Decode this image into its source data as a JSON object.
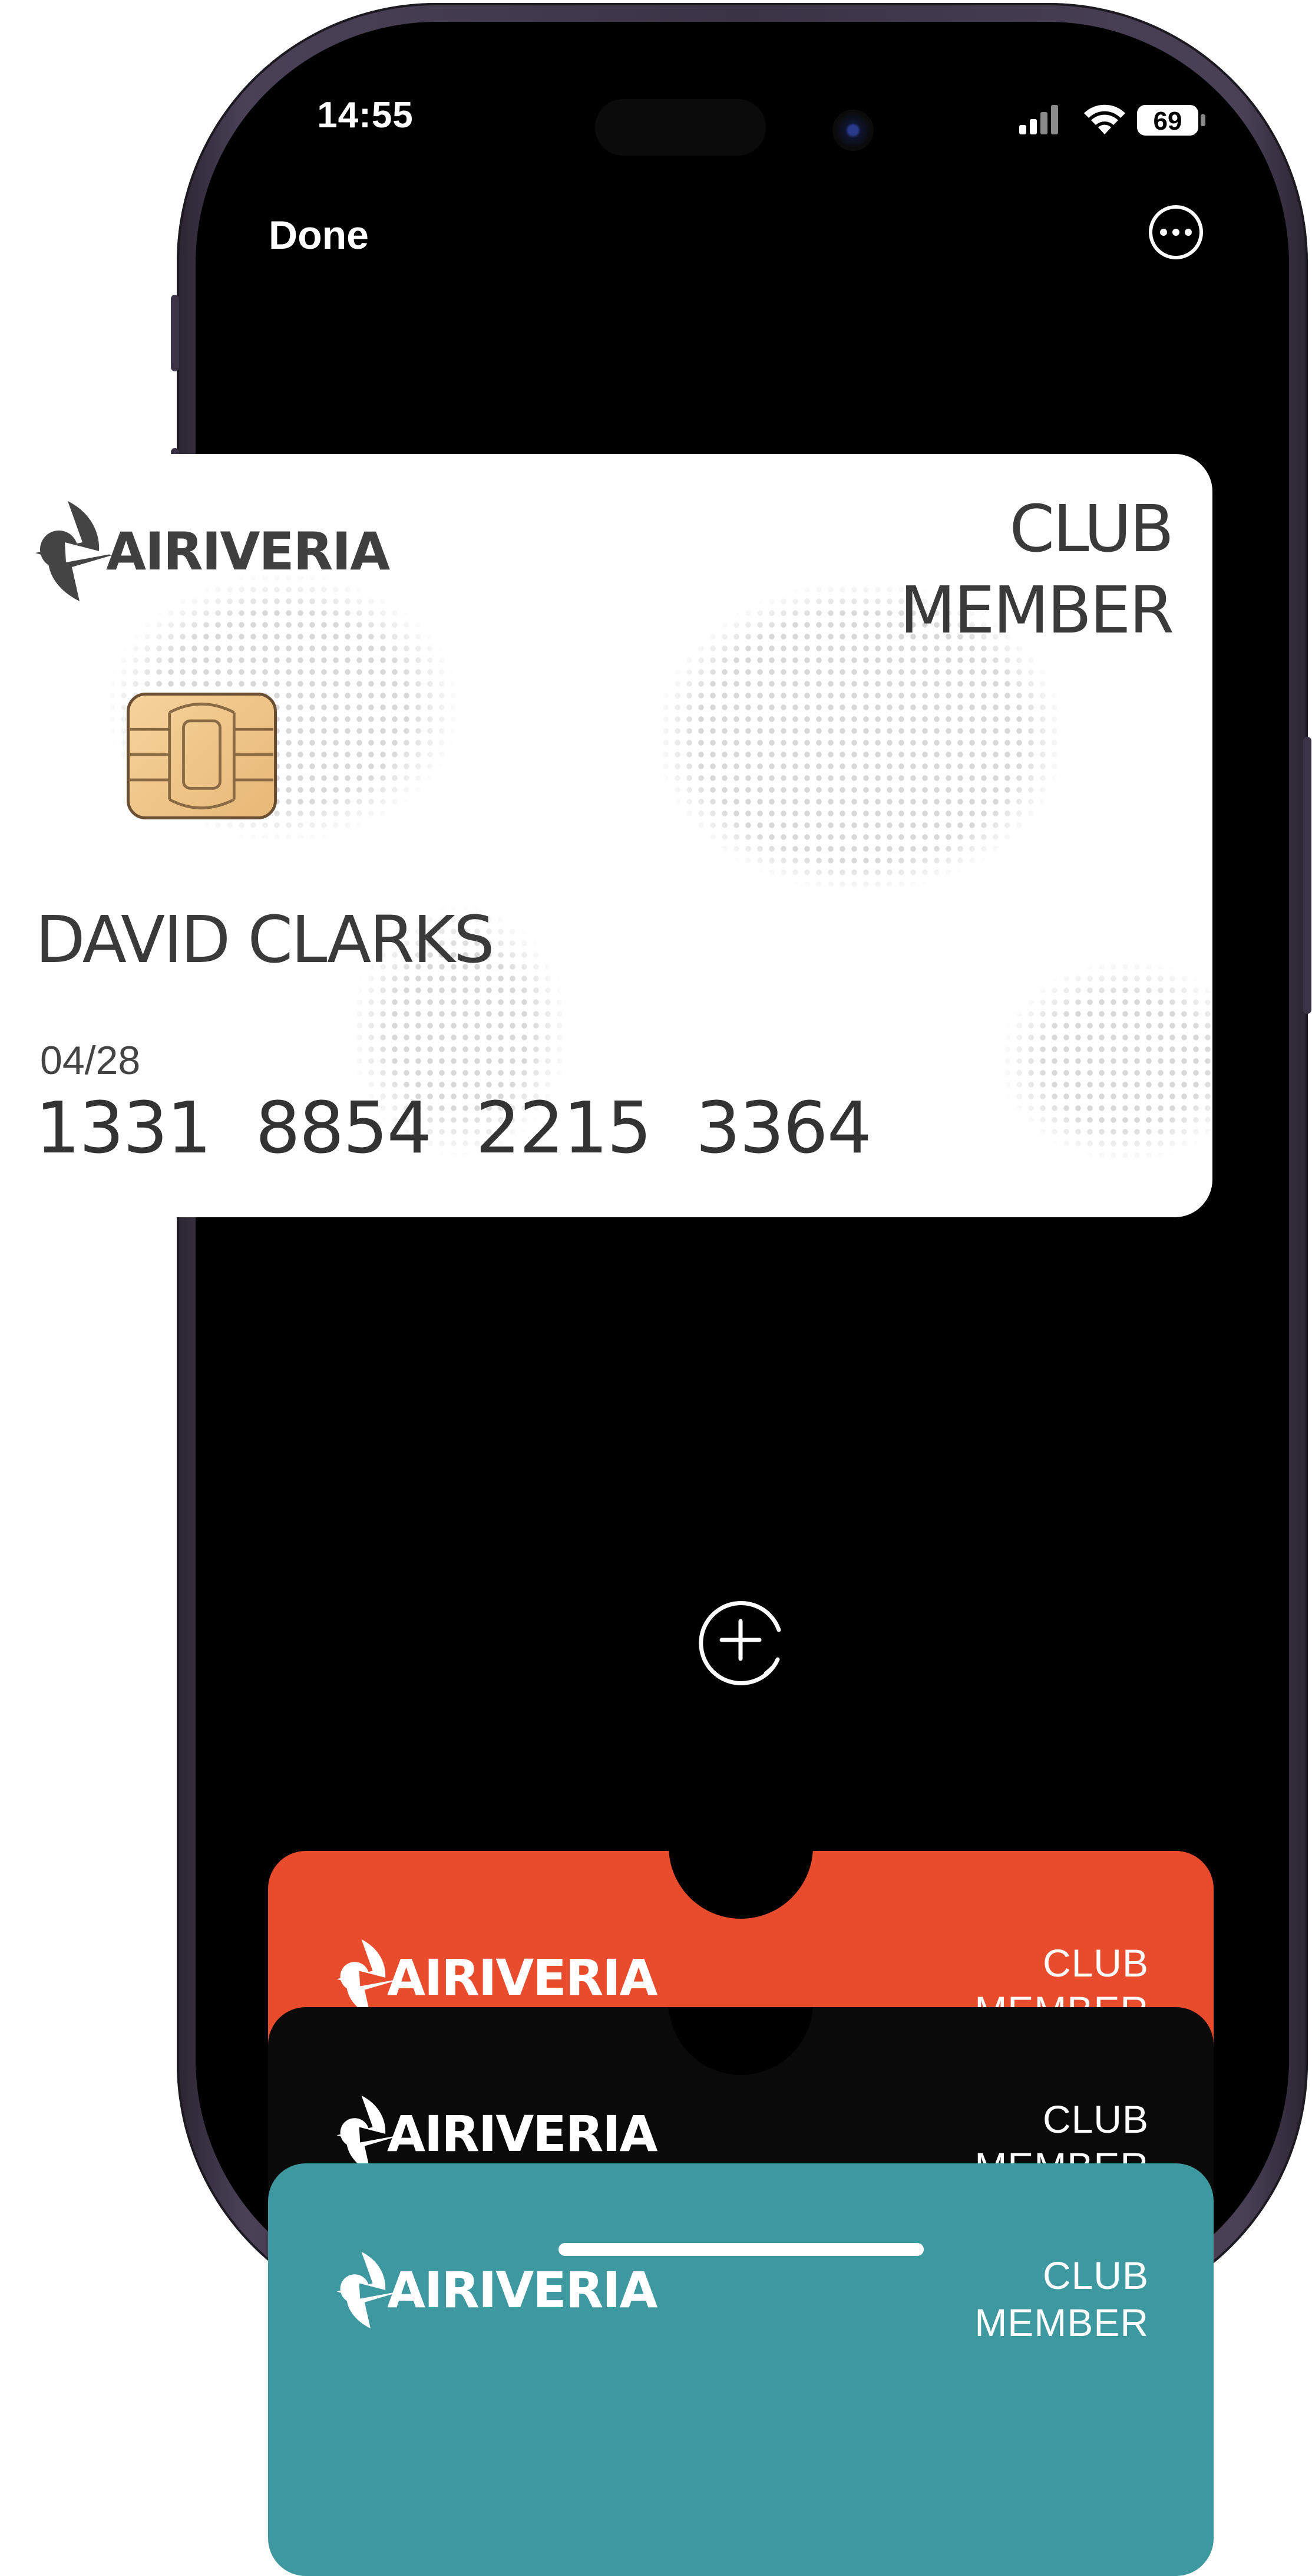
{
  "status_bar": {
    "time": "14:55",
    "battery_level": "69"
  },
  "header": {
    "done_label": "Done",
    "more_icon": "ellipsis-circle-icon"
  },
  "main_card": {
    "brand": "AIRIVERIA",
    "tier_line1": "CLUB",
    "tier_line2": "MEMBER",
    "holder_name": "DAVID CLARKS",
    "expiry": "04/28",
    "card_number": "1331 8854 2215 3364",
    "background": "#ffffff",
    "text_color": "#3a3a3a"
  },
  "add_button_icon": "add-circle-icon",
  "passes": [
    {
      "brand": "AIRIVERIA",
      "tier_line1": "CLUB",
      "tier_line2": "MEMBER",
      "color": "#e94b2d"
    },
    {
      "brand": "AIRIVERIA",
      "tier_line1": "CLUB",
      "tier_line2": "MEMBER",
      "color": "#0a0a0a"
    },
    {
      "brand": "AIRIVERIA",
      "tier_line1": "CLUB",
      "tier_line2": "MEMBER",
      "color": "#3d98a0"
    }
  ]
}
